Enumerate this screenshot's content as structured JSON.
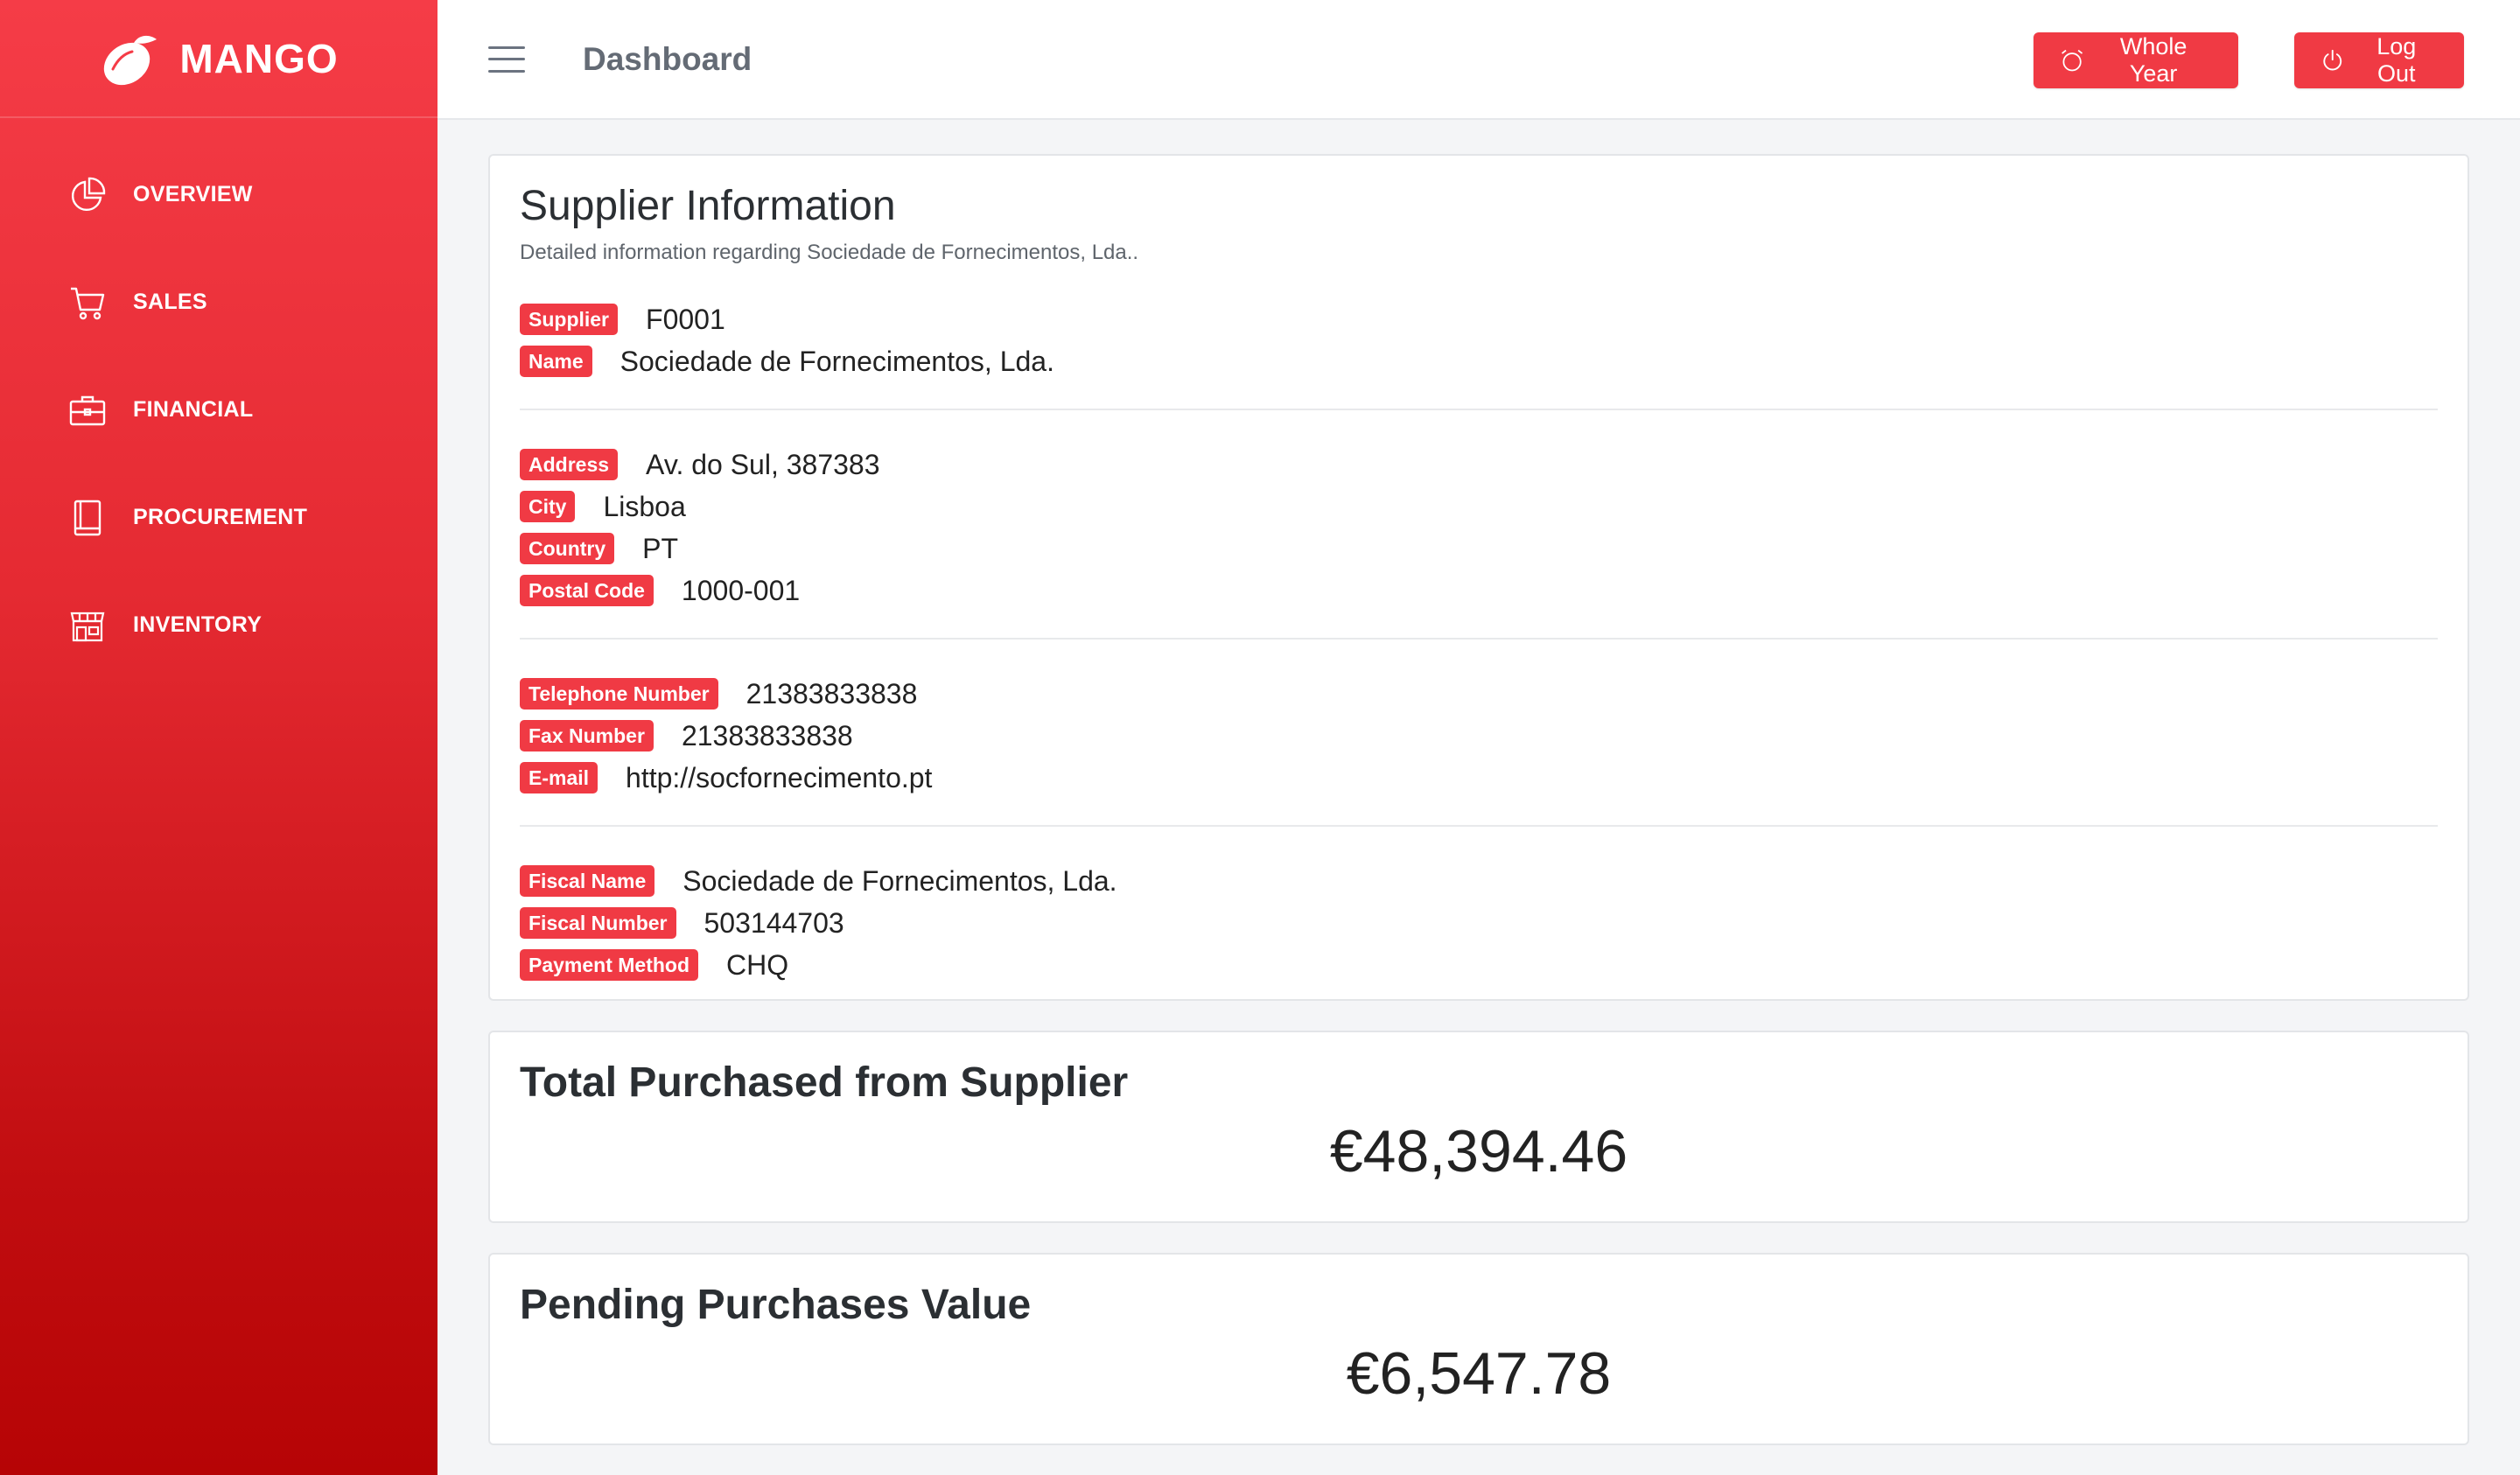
{
  "brand": {
    "name": "MANGO"
  },
  "sidebar": {
    "items": [
      {
        "label": "OVERVIEW",
        "icon": "pie-chart-icon"
      },
      {
        "label": "SALES",
        "icon": "cart-icon"
      },
      {
        "label": "FINANCIAL",
        "icon": "briefcase-icon"
      },
      {
        "label": "PROCUREMENT",
        "icon": "book-icon"
      },
      {
        "label": "INVENTORY",
        "icon": "store-icon"
      }
    ]
  },
  "header": {
    "title": "Dashboard",
    "whole_year_label": "Whole Year",
    "logout_label": "Log Out"
  },
  "supplier": {
    "title": "Supplier Information",
    "subtitle": "Detailed information regarding Sociedade de Fornecimentos, Lda..",
    "groups": [
      [
        {
          "label": "Supplier",
          "value": "F0001"
        },
        {
          "label": "Name",
          "value": "Sociedade de Fornecimentos, Lda."
        }
      ],
      [
        {
          "label": "Address",
          "value": "Av. do Sul, 387383"
        },
        {
          "label": "City",
          "value": "Lisboa"
        },
        {
          "label": "Country",
          "value": "PT"
        },
        {
          "label": "Postal Code",
          "value": "1000-001"
        }
      ],
      [
        {
          "label": "Telephone Number",
          "value": "21383833838"
        },
        {
          "label": "Fax Number",
          "value": "21383833838"
        },
        {
          "label": "E-mail",
          "value": "http://socfornecimento.pt"
        }
      ],
      [
        {
          "label": "Fiscal Name",
          "value": "Sociedade de Fornecimentos, Lda."
        },
        {
          "label": "Fiscal Number",
          "value": "503144703"
        },
        {
          "label": "Payment Method",
          "value": "CHQ"
        }
      ]
    ]
  },
  "total": {
    "title": "Total Purchased from Supplier",
    "value": "€48,394.46"
  },
  "pending": {
    "title": "Pending Purchases Value",
    "value": "€6,547.78"
  },
  "colors": {
    "accent": "#f03a44",
    "sidebar_top": "#f53c47",
    "sidebar_bottom": "#b60405"
  }
}
